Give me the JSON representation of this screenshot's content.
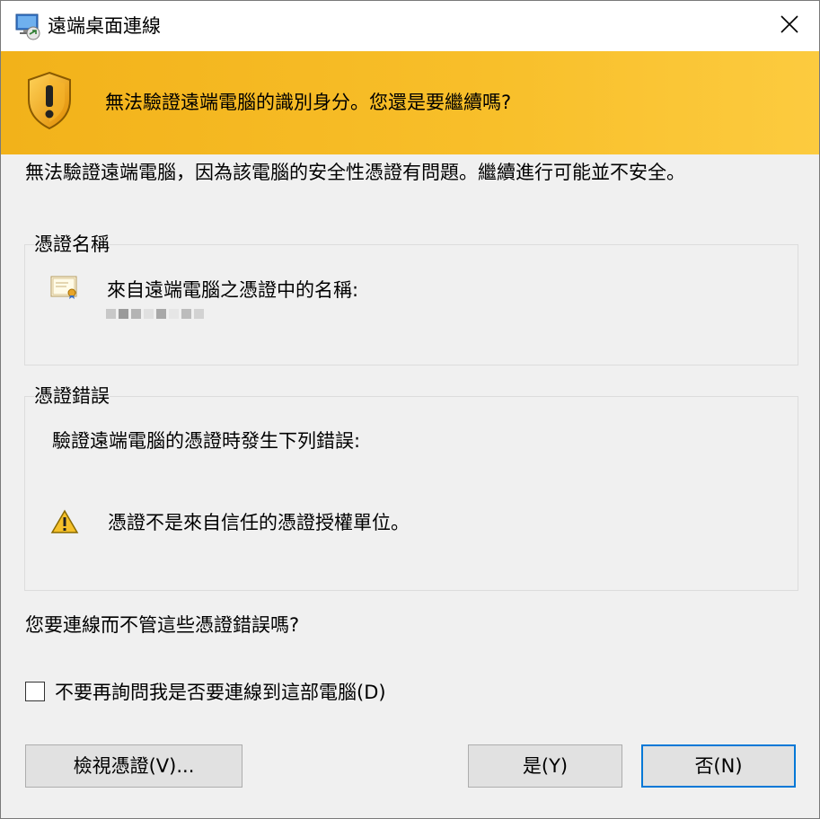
{
  "window": {
    "title": "遠端桌面連線",
    "title_icon": "remote-desktop-icon",
    "close_icon": "close-icon"
  },
  "banner": {
    "icon": "shield-warning-icon",
    "text": "無法驗證遠端電腦的識別身分。您還是要繼續嗎?",
    "colors": {
      "from": "#f2b21a",
      "to": "#fccb3f"
    }
  },
  "intro": "無法驗證遠端電腦，因為該電腦的安全性憑證有問題。繼續進行可能並不安全。",
  "cert_name": {
    "group_title": "憑證名稱",
    "icon": "certificate-icon",
    "label": "來自遠端電腦之憑證中的名稱:"
  },
  "cert_errors": {
    "group_title": "憑證錯誤",
    "intro": "驗證遠端電腦的憑證時發生下列錯誤:",
    "icon": "warning-icon",
    "error": "憑證不是來自信任的憑證授權單位。"
  },
  "question": "您要連線而不管這些憑證錯誤嗎?",
  "checkbox": {
    "label": "不要再詢問我是否要連線到這部電腦(D)",
    "checked": false
  },
  "buttons": {
    "view_cert": "檢視憑證(V)...",
    "yes": "是(Y)",
    "no": "否(N)"
  },
  "accent_color": "#0078d7"
}
